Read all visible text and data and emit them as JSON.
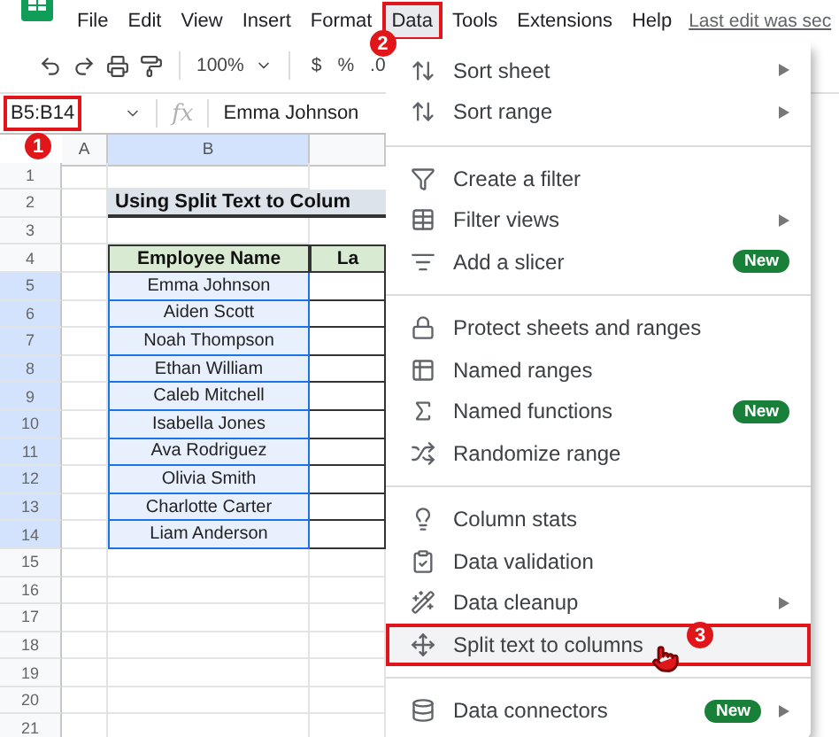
{
  "menu_bar": {
    "items": [
      {
        "label": "File",
        "selected": false
      },
      {
        "label": "Edit",
        "selected": false
      },
      {
        "label": "View",
        "selected": false
      },
      {
        "label": "Insert",
        "selected": false
      },
      {
        "label": "Format",
        "selected": false
      },
      {
        "label": "Data",
        "selected": true,
        "callout": "2"
      },
      {
        "label": "Tools",
        "selected": false
      },
      {
        "label": "Extensions",
        "selected": false
      },
      {
        "label": "Help",
        "selected": false
      }
    ],
    "last_edit": "Last edit was sec"
  },
  "toolbar": {
    "zoom": "100%",
    "format_buttons": [
      "$",
      "%",
      ".0"
    ]
  },
  "formula_bar": {
    "name_box": "B5:B14",
    "callout": "1",
    "fx": "fx",
    "value": "Emma Johnson"
  },
  "sheet": {
    "columns": [
      "A",
      "B"
    ],
    "rows": [
      "1",
      "2",
      "3",
      "4",
      "5",
      "6",
      "7",
      "8",
      "9",
      "10",
      "11",
      "12",
      "13",
      "14",
      "15",
      "16",
      "17",
      "18",
      "19",
      "20",
      "21"
    ],
    "title": "Using Split Text to Colum",
    "headers": [
      "Employee Name",
      "La"
    ],
    "names": [
      {
        "text": "Emma Johnson",
        "selected": true
      },
      {
        "text": "Aiden Scott",
        "selected": true
      },
      {
        "text": "Noah Thompson",
        "selected": true
      },
      {
        "text": "Ethan William",
        "selected": true
      },
      {
        "text": "Caleb Mitchell",
        "selected": true
      },
      {
        "text": "Isabella Jones",
        "selected": true
      },
      {
        "text": "Ava Rodriguez",
        "selected": true
      },
      {
        "text": "Olivia Smith",
        "selected": true
      },
      {
        "text": "Charlotte Carter",
        "selected": true
      },
      {
        "text": "Liam Anderson",
        "selected": true
      }
    ]
  },
  "data_menu": {
    "sections": [
      [
        {
          "label": "Sort sheet",
          "submenu": true
        },
        {
          "label": "Sort range",
          "submenu": true
        }
      ],
      [
        {
          "label": "Create a filter",
          "submenu": false
        },
        {
          "label": "Filter views",
          "submenu": true
        },
        {
          "label": "Add a slicer",
          "submenu": false,
          "badge": "New"
        }
      ],
      [
        {
          "label": "Protect sheets and ranges",
          "submenu": false
        },
        {
          "label": "Named ranges",
          "submenu": false
        },
        {
          "label": "Named functions",
          "submenu": false,
          "badge": "New"
        },
        {
          "label": "Randomize range",
          "submenu": false
        }
      ],
      [
        {
          "label": "Column stats",
          "submenu": false
        },
        {
          "label": "Data validation",
          "submenu": false
        },
        {
          "label": "Data cleanup",
          "submenu": true
        },
        {
          "label": "Split text to columns",
          "submenu": false,
          "highlighted": true,
          "callout": "3"
        }
      ],
      [
        {
          "label": "Data connectors",
          "submenu": true,
          "badge": "New"
        }
      ]
    ]
  }
}
